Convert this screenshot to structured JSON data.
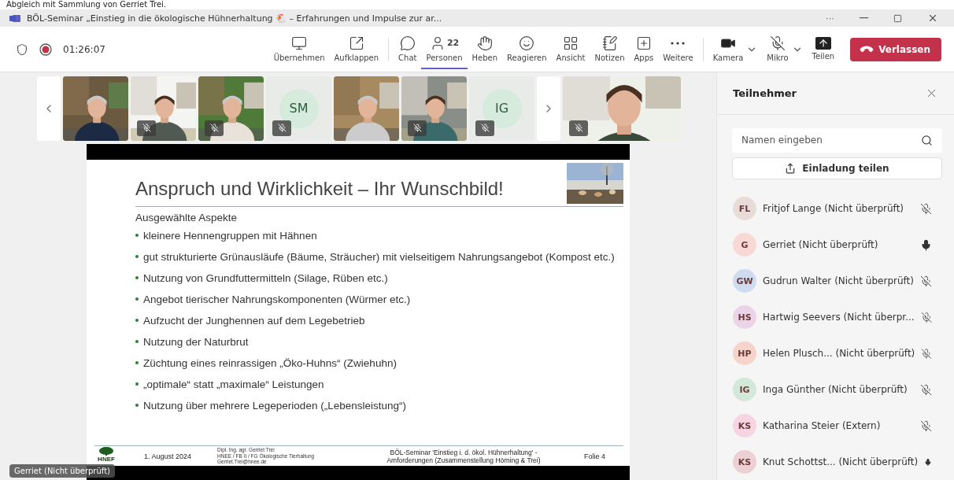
{
  "caption": "Abgleich mit Sammlung von Gerriet Trei.",
  "window": {
    "title": "BÖL-Seminar „Einstieg in die ökologische Hühnerhaltung 🐔 – Erfahrungen und Impulse zur ar...",
    "more": "···"
  },
  "meeting": {
    "recording": true,
    "time": "01:26:07"
  },
  "toolbar": [
    {
      "label": "Übernehmen",
      "kind": "button",
      "selected": false
    },
    {
      "label": "Aufklappen",
      "kind": "button",
      "selected": false
    },
    {
      "label": "Chat",
      "kind": "button",
      "selected": false
    },
    {
      "label": "Personen",
      "kind": "button",
      "selected": true,
      "count": "22"
    },
    {
      "label": "Heben",
      "kind": "button",
      "selected": false
    },
    {
      "label": "Reagieren",
      "kind": "button",
      "selected": false
    },
    {
      "label": "Ansicht",
      "kind": "button",
      "selected": false
    },
    {
      "label": "Notizen",
      "kind": "button",
      "selected": false
    },
    {
      "label": "Apps",
      "kind": "button",
      "selected": false
    },
    {
      "label": "Weitere",
      "kind": "button",
      "selected": false
    },
    {
      "label": "Kamera",
      "kind": "split",
      "selected": false
    },
    {
      "label": "Mikro",
      "kind": "split",
      "selected": false
    },
    {
      "label": "Teilen",
      "kind": "button",
      "selected": false
    }
  ],
  "leave_button": "Verlassen",
  "gallery": [
    {
      "kind": "picture",
      "muted": false
    },
    {
      "kind": "picture",
      "muted": true
    },
    {
      "kind": "picture",
      "muted": true
    },
    {
      "kind": "initials",
      "initials": "SM",
      "muted": true
    },
    {
      "kind": "picture",
      "muted": false
    },
    {
      "kind": "picture",
      "muted": true
    },
    {
      "kind": "initials",
      "initials": "IG",
      "muted": true
    },
    {
      "kind": "picture",
      "muted": true,
      "wide": true
    }
  ],
  "slide": {
    "title": "Anspruch und Wirklichkeit – Ihr Wunschbild!",
    "subtitle": "Ausgewählte Aspekte",
    "bullets": [
      "kleinere Hennengruppen mit Hähnen",
      "gut strukturierte Grünausläufe (Bäume, Sträucher) mit vielseitigem Nahrungsangebot (Kompost etc.)",
      "Nutzung von Grundfuttermitteln (Silage, Rüben etc.)",
      "Angebot tierischer Nahrungskomponenten (Würmer etc.)",
      "Aufzucht der Junghennen auf dem Legebetrieb",
      "Nutzung der Naturbrut",
      "Züchtung eines reinrassigen „Öko-Huhns“ (Zwiehuhn)",
      "„optimale“ statt „maximale“ Leistungen",
      "Nutzung über mehrere Legeperioden („Lebensleistung“)"
    ],
    "footer": {
      "logo": "HNEF",
      "date": "1. August 2024",
      "author": [
        "Dipl. Ing. agr. Gerriet Trei",
        "HNEE / FB II / FG Ökologische Tierhaltung",
        "Gerriet.Trei@hnee.de"
      ],
      "seminar": [
        "BÖL-Seminar 'Einstieg i. d. ökol. Hühnerhaltung' -",
        "Amforderungen (Zusammenstellung Hörning & Trei)"
      ],
      "page": "Folie 4"
    }
  },
  "speaker_label": "Gerriet (Nicht überprüft)",
  "panel": {
    "title": "Teilnehmer",
    "search": {
      "placeholder": "Namen eingeben"
    },
    "invite_button": "Einladung teilen",
    "participants": [
      {
        "initials": "FL",
        "name": "Fritjof Lange",
        "status": "(Nicht überprüft)",
        "color": "#e8dcd8",
        "muted": true
      },
      {
        "initials": "G",
        "name": "Gerriet",
        "status": "(Nicht überprüft)",
        "color": "#f8d8d4",
        "muted": false
      },
      {
        "initials": "GW",
        "name": "Gudrun Walter",
        "status": "(Nicht überprüft)",
        "color": "#cfdcf0",
        "muted": true
      },
      {
        "initials": "HS",
        "name": "Hartwig Seevers",
        "status": "(Nicht überpr...",
        "color": "#ecd4e8",
        "muted": true
      },
      {
        "initials": "HP",
        "name": "Helen Plusch...",
        "status": "(Nicht überprüft)",
        "color": "#f6d4cc",
        "muted": true
      },
      {
        "initials": "IG",
        "name": "Inga Günther",
        "status": "(Nicht überprüft)",
        "color": "#d4e8da",
        "muted": true
      },
      {
        "initials": "KS",
        "name": "Katharina Steier",
        "status": "(Extern)",
        "color": "#f6d4e2",
        "muted": true
      },
      {
        "initials": "KS",
        "name": "Knut Schottst...",
        "status": "(Nicht überprüft)",
        "color": "#ecd0d4",
        "muted": false
      }
    ]
  }
}
